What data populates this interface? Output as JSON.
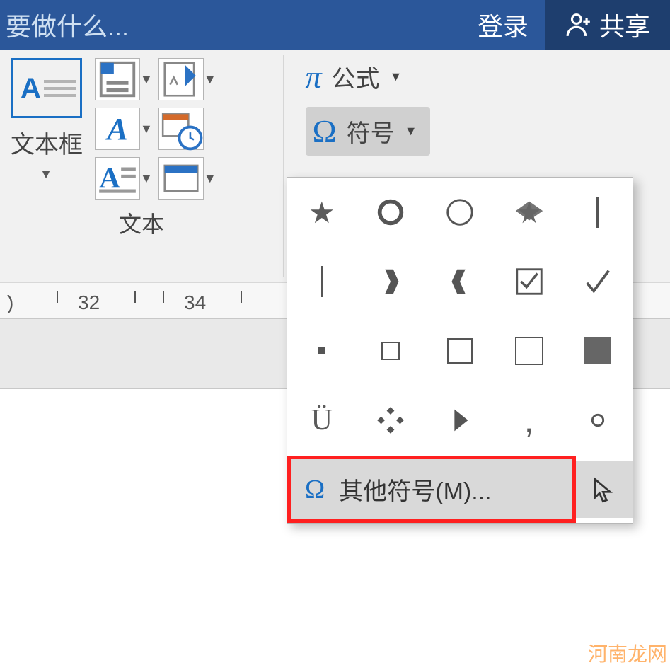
{
  "titlebar": {
    "search_placeholder": "要做什么...",
    "login_label": "登录",
    "share_label": "共享"
  },
  "ribbon": {
    "text_group": {
      "textbox_label": "文本框",
      "group_label": "文本"
    },
    "symbol_group": {
      "equation_label": "公式",
      "symbol_label": "符号"
    }
  },
  "ruler": {
    "marks": [
      "32",
      "34"
    ]
  },
  "symbol_popup": {
    "symbols": [
      "star-filled",
      "circle-bold",
      "circle-thin",
      "star-band",
      "bar-vertical",
      "bar-thin",
      "bracket-right",
      "bracket-left",
      "checkbox-checked",
      "checkmark",
      "dot-small",
      "square-small",
      "square-medium",
      "square-outline",
      "square-filled",
      "u-diaeresis",
      "diamond-cluster",
      "triangle-right",
      "comma",
      "dot-hollow"
    ],
    "more_label": "其他符号(M)..."
  },
  "watermark": "河南龙网"
}
